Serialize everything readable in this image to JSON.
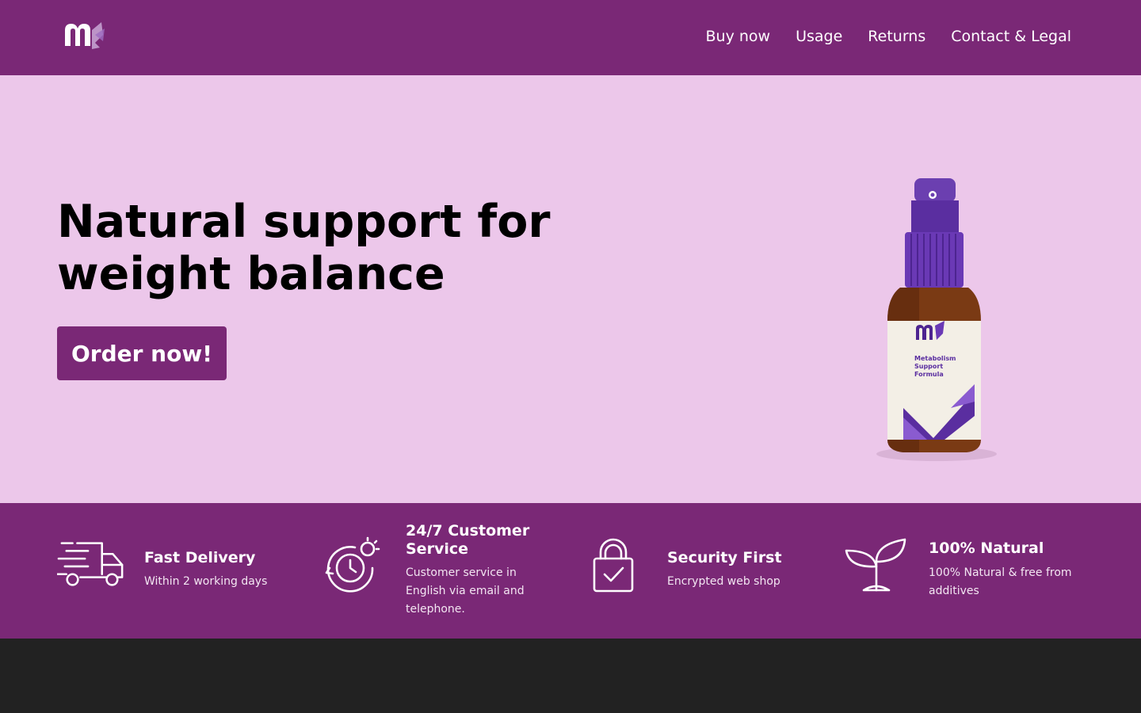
{
  "header": {
    "logo_icon": "ms-logo",
    "nav": [
      {
        "label": "Buy now"
      },
      {
        "label": "Usage"
      },
      {
        "label": "Returns"
      },
      {
        "label": "Contact & Legal"
      }
    ]
  },
  "hero": {
    "title": "Natural support for weight balance",
    "order_button": "Order now!",
    "product": {
      "icon": "spray-bottle-image",
      "label_line1": "Metabolism",
      "label_line2": "Support",
      "label_line3": "Formula"
    }
  },
  "features": [
    {
      "icon": "delivery-truck-icon",
      "title": "Fast Delivery",
      "text": "Within 2 working days"
    },
    {
      "icon": "clock-customer-service-icon",
      "title": "24/7 Customer Service",
      "text": "Customer service in English via email and telephone."
    },
    {
      "icon": "padlock-icon",
      "title": "Security First",
      "text": "Encrypted web shop"
    },
    {
      "icon": "plant-sprout-icon",
      "title": "100% Natural",
      "text": "100% Natural & free from additives"
    }
  ],
  "colors": {
    "brand_purple": "#7a2876",
    "hero_background": "#ecc7ea",
    "footer_background": "#222222"
  }
}
